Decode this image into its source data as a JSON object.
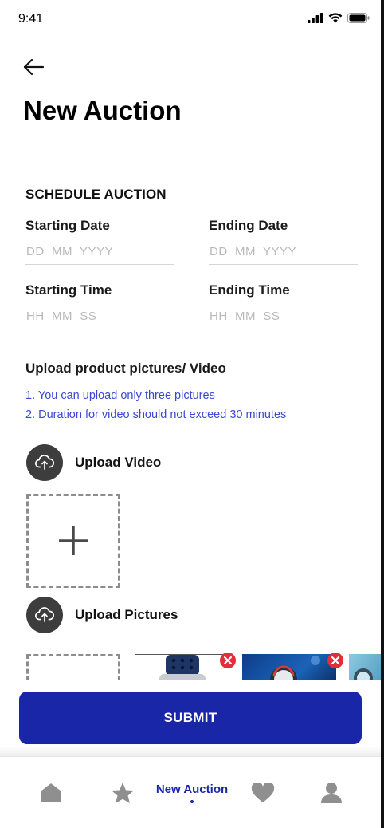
{
  "status_bar": {
    "time": "9:41"
  },
  "page": {
    "title": "New Auction"
  },
  "schedule": {
    "heading": "SCHEDULE AUCTION",
    "starting_date": {
      "label": "Starting Date",
      "placeholder": "DD  MM  YYYY",
      "value": ""
    },
    "ending_date": {
      "label": "Ending Date",
      "placeholder": "DD  MM  YYYY",
      "value": ""
    },
    "starting_time": {
      "label": "Starting Time",
      "placeholder": "HH  MM  SS",
      "value": ""
    },
    "ending_time": {
      "label": "Ending Time",
      "placeholder": "HH  MM  SS",
      "value": ""
    }
  },
  "upload": {
    "heading": "Upload product pictures/ Video",
    "notes": [
      "1. You can upload only three pictures",
      "2. Duration for video should not exceed 30 minutes"
    ],
    "video_label": "Upload Video",
    "pictures_label": "Upload Pictures",
    "icon": "cloud-upload-icon",
    "thumbnails": [
      {
        "name": "watch-photo-1",
        "removable": true
      },
      {
        "name": "watch-photo-2",
        "removable": true
      },
      {
        "name": "watch-photo-3",
        "removable": false
      }
    ]
  },
  "submit_label": "SUBMIT",
  "bottom_nav": {
    "items": [
      {
        "icon": "home-icon",
        "label": ""
      },
      {
        "icon": "star-icon",
        "label": ""
      },
      {
        "icon": "",
        "label": "New Auction",
        "active": true
      },
      {
        "icon": "heart-icon",
        "label": ""
      },
      {
        "icon": "user-icon",
        "label": ""
      }
    ]
  },
  "colors": {
    "primary": "#1a26a8",
    "note_text": "#3a47d6",
    "remove_badge": "#e52c3a",
    "icon_gray": "#8f8f8f"
  }
}
